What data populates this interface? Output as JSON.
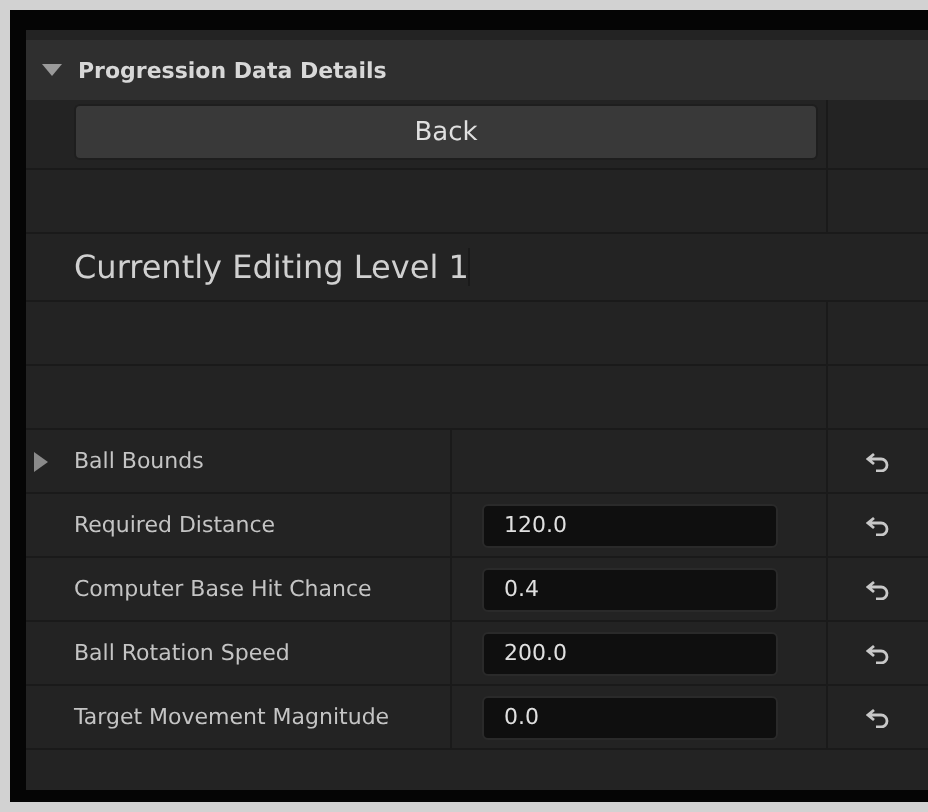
{
  "panel": {
    "title": "Progression Data Details",
    "expanded": true
  },
  "back_button": {
    "label": "Back"
  },
  "heading": "Currently Editing Level 1",
  "properties": [
    {
      "kind": "group",
      "name": "Ball Bounds",
      "expanded": false
    },
    {
      "kind": "field",
      "name": "Required Distance",
      "value": "120.0"
    },
    {
      "kind": "field",
      "name": "Computer Base Hit Chance",
      "value": "0.4"
    },
    {
      "kind": "field",
      "name": "Ball Rotation Speed",
      "value": "200.0"
    },
    {
      "kind": "field",
      "name": "Target Movement Magnitude",
      "value": "0.0"
    }
  ]
}
